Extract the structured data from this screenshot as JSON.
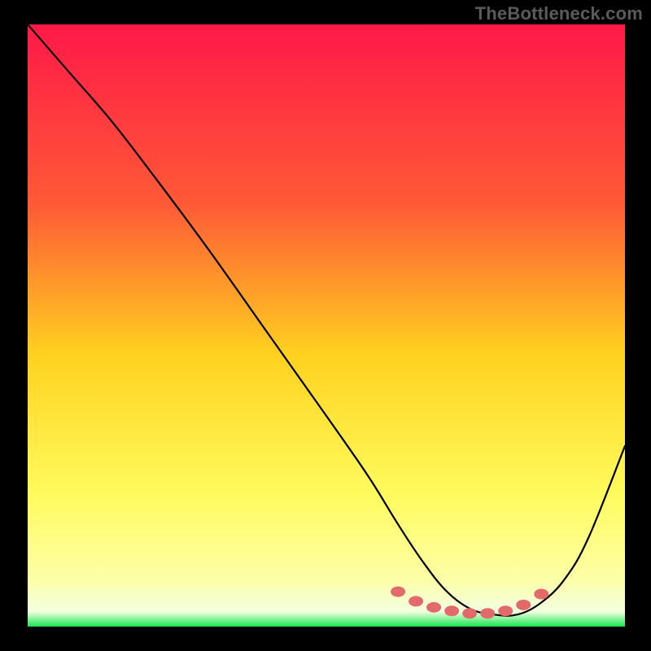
{
  "watermark": "TheBottleneck.com",
  "chart_data": {
    "type": "line",
    "title": "",
    "xlabel": "",
    "ylabel": "",
    "xlim": [
      0,
      100
    ],
    "ylim": [
      0,
      100
    ],
    "gradient_stops": [
      {
        "offset": 0,
        "color": "#ff1948"
      },
      {
        "offset": 0.3,
        "color": "#ff5a36"
      },
      {
        "offset": 0.55,
        "color": "#ffd21f"
      },
      {
        "offset": 0.78,
        "color": "#fffb5d"
      },
      {
        "offset": 0.92,
        "color": "#fdffa6"
      },
      {
        "offset": 0.975,
        "color": "#f3ffe0"
      },
      {
        "offset": 1.0,
        "color": "#17e651"
      }
    ],
    "series": [
      {
        "name": "bottleneck-curve",
        "x": [
          0,
          7,
          14,
          21,
          30,
          40,
          50,
          57,
          62,
          66,
          70,
          74,
          78,
          82,
          86,
          90,
          94,
          100
        ],
        "values": [
          100,
          92,
          84,
          75,
          63,
          49,
          35,
          25,
          17,
          11,
          6,
          3,
          2,
          2,
          4,
          8,
          15,
          30
        ]
      }
    ],
    "markers": {
      "name": "highlight-dots",
      "color": "#e36a6a",
      "points": [
        {
          "x": 62,
          "y": 5.8
        },
        {
          "x": 65,
          "y": 4.2
        },
        {
          "x": 68,
          "y": 3.2
        },
        {
          "x": 71,
          "y": 2.6
        },
        {
          "x": 74,
          "y": 2.2
        },
        {
          "x": 77,
          "y": 2.2
        },
        {
          "x": 80,
          "y": 2.6
        },
        {
          "x": 83,
          "y": 3.6
        },
        {
          "x": 86,
          "y": 5.4
        }
      ]
    }
  }
}
